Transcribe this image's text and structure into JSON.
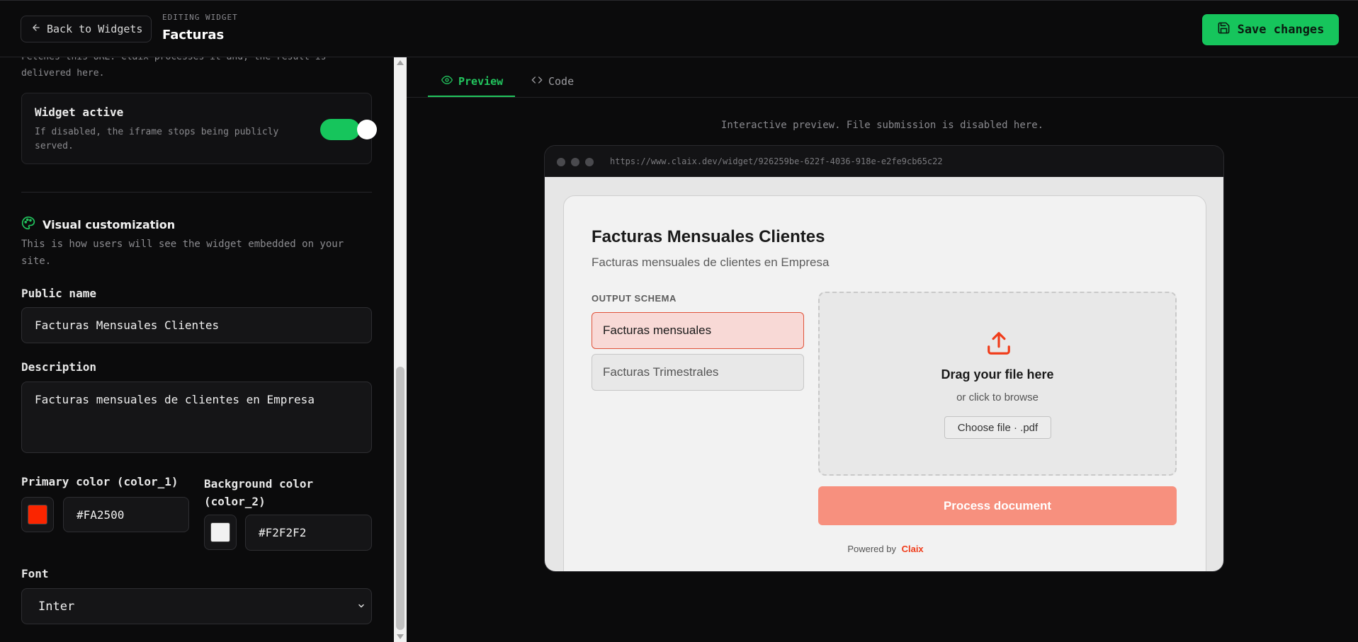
{
  "header": {
    "back_label": "Back to Widgets",
    "editing_label": "EDITING WIDGET",
    "widget_name": "Facturas",
    "save_label": "Save changes"
  },
  "left": {
    "cut_text": "Fetches this URL. Claix processes it and, the result is delivered here.",
    "toggle": {
      "title": "Widget active",
      "description": "If disabled, the iframe stops being publicly served.",
      "on": true
    },
    "visual": {
      "title": "Visual customization",
      "description": "This is how users will see the widget embedded on your site."
    },
    "public_name": {
      "label": "Public name",
      "value": "Facturas Mensuales Clientes"
    },
    "description": {
      "label": "Description",
      "value": "Facturas mensuales de clientes en Empresa"
    },
    "primary_color": {
      "label": "Primary color (color_1)",
      "value": "#FA2500"
    },
    "background_color": {
      "label": "Background color (color_2)",
      "value": "#F2F2F2"
    },
    "font": {
      "label": "Font",
      "value": "Inter"
    }
  },
  "right": {
    "tabs": [
      {
        "label": "Preview",
        "active": true
      },
      {
        "label": "Code",
        "active": false
      }
    ],
    "hint": "Interactive preview. File submission is disabled here.",
    "url": "https://www.claix.dev/widget/926259be-622f-4036-918e-e2fe9cb65c22"
  },
  "widget": {
    "title": "Facturas Mensuales Clientes",
    "description": "Facturas mensuales de clientes en Empresa",
    "schema_label": "OUTPUT SCHEMA",
    "schemas": [
      "Facturas mensuales",
      "Facturas Trimestrales"
    ],
    "drop_title": "Drag your file here",
    "drop_sub": "or click to browse",
    "choose_label": "Choose file · .pdf",
    "process_label": "Process document",
    "powered_by": "Powered by",
    "brand": "Claix"
  },
  "colors": {
    "accent": "#16c55c",
    "primary": "#FA2500",
    "background": "#F2F2F2"
  }
}
